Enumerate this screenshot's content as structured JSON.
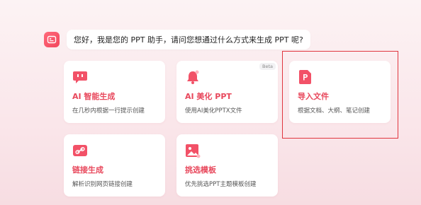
{
  "assistant": {
    "message": "您好，我是您的 PPT 助手，请问您想通过什么方式来生成 PPT 呢?"
  },
  "cards": [
    {
      "title": "AI 智能生成",
      "desc": "在几秒内根据一行提示创建",
      "icon": "chat-bubble-icon"
    },
    {
      "title": "AI 美化 PPT",
      "desc": "使用AI美化PPTX文件",
      "icon": "bell-sparkle-icon",
      "badge": "Beta"
    },
    {
      "title": "导入文件",
      "desc": "根据文档、大纲、笔记创建",
      "icon": "ppt-file-icon"
    },
    {
      "title": "链接生成",
      "desc": "解析识别网页链接创建",
      "icon": "link-icon"
    },
    {
      "title": "挑选模板",
      "desc": "优先挑选PPT主题模板创建",
      "icon": "image-template-icon"
    }
  ],
  "colors": {
    "accent": "#e8485c",
    "highlight_border": "#e0363f"
  }
}
